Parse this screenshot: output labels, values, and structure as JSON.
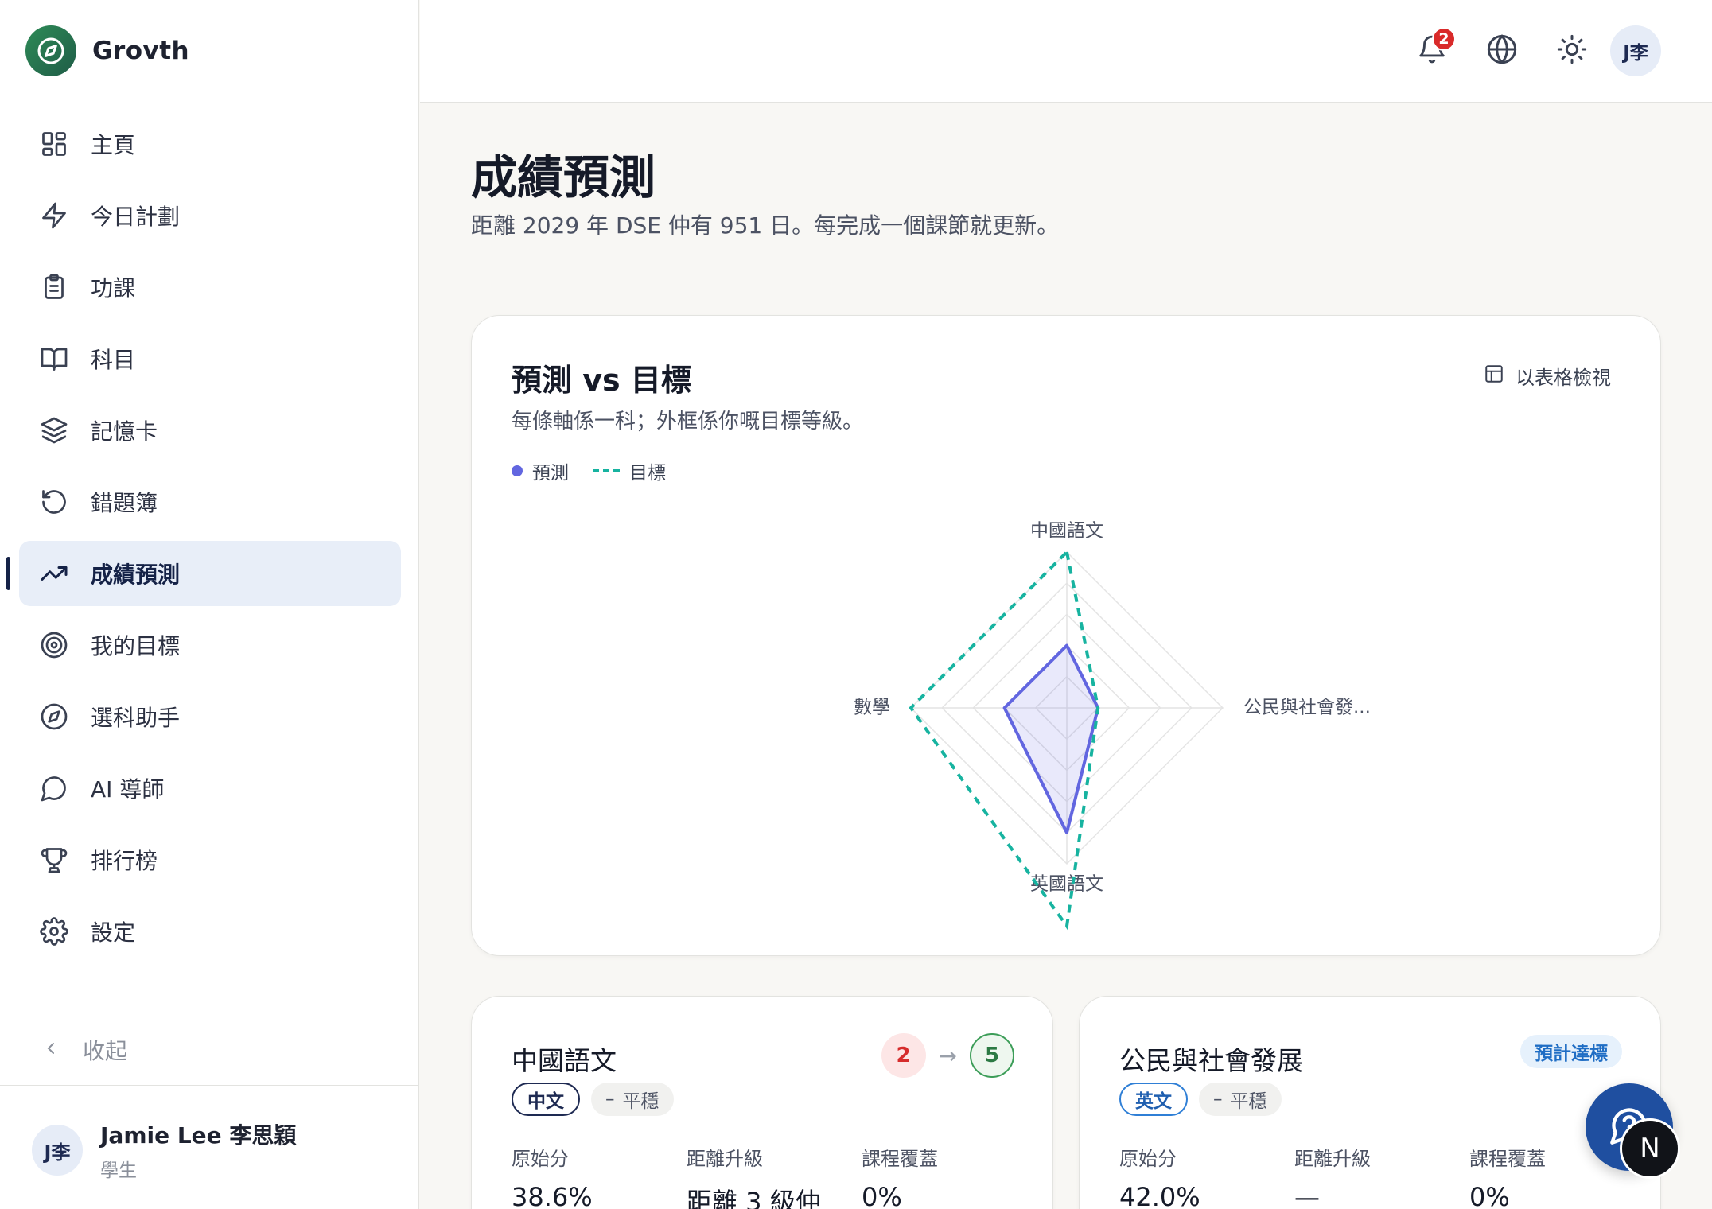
{
  "brand": {
    "name": "Grovth",
    "logo_icon": "compass-icon"
  },
  "sidebar": {
    "items": [
      {
        "label": "主頁",
        "icon": "dashboard-grid-icon"
      },
      {
        "label": "今日計劃",
        "icon": "lightning-icon"
      },
      {
        "label": "功課",
        "icon": "clipboard-icon"
      },
      {
        "label": "科目",
        "icon": "book-icon"
      },
      {
        "label": "記憶卡",
        "icon": "layers-icon"
      },
      {
        "label": "錯題簿",
        "icon": "rotate-ccw-icon"
      },
      {
        "label": "成績預測",
        "icon": "trending-up-icon",
        "active": true
      },
      {
        "label": "我的目標",
        "icon": "target-icon"
      },
      {
        "label": "選科助手",
        "icon": "compass-icon"
      },
      {
        "label": "AI 導師",
        "icon": "chat-bubble-icon"
      },
      {
        "label": "排行榜",
        "icon": "trophy-icon"
      },
      {
        "label": "設定",
        "icon": "gear-icon"
      }
    ],
    "collapse_label": "收起"
  },
  "user": {
    "avatar": "J李",
    "name": "Jamie Lee 李思穎",
    "role": "學生"
  },
  "topbar": {
    "notification_count": "2",
    "avatar": "J李"
  },
  "page": {
    "title": "成績預測",
    "subtitle": "距離 2029 年 DSE 仲有 951 日。每完成一個課節就更新。"
  },
  "chart_card": {
    "title": "預測 vs 目標",
    "subtitle": "每條軸係一科；外框係你嘅目標等級。",
    "table_view_label": "以表格檢視"
  },
  "chart_data": {
    "type": "radar",
    "axes": [
      "中國語文",
      "公民與社會發...",
      "英國語文",
      "數學"
    ],
    "rlim": [
      0,
      5
    ],
    "grid_levels": 5,
    "series": [
      {
        "name": "預測",
        "values": [
          2,
          1,
          4,
          2
        ],
        "color": "#6266e0",
        "style": "solid-filled"
      },
      {
        "name": "目標",
        "values": [
          5,
          1,
          7,
          5
        ],
        "color": "#17b3a0",
        "style": "dashed"
      }
    ],
    "legend_position": "top-left"
  },
  "subject_cards": [
    {
      "name": "中國語文",
      "lang_tag": "中文",
      "trend": "平穩",
      "current_grade": "2",
      "target_grade": "5",
      "stats": [
        {
          "label": "原始分",
          "value": "38.6%"
        },
        {
          "label": "距離升級",
          "value": "距離 3 級仲"
        },
        {
          "label": "課程覆蓋",
          "value": "0%"
        }
      ]
    },
    {
      "name": "公民與社會發展",
      "lang_tag": "英文",
      "trend": "平穩",
      "status": "預計達標",
      "stats": [
        {
          "label": "原始分",
          "value": "42.0%"
        },
        {
          "label": "距離升級",
          "value": "—"
        },
        {
          "label": "課程覆蓋",
          "value": "0%"
        }
      ]
    }
  ],
  "fab": {
    "help_icon": "help-chat-icon",
    "overlay_letter": "N"
  },
  "colors": {
    "accent": "#152247",
    "predicted": "#6266e0",
    "target": "#17b3a0",
    "danger": "#d92a2a",
    "success": "#3c9d58"
  }
}
